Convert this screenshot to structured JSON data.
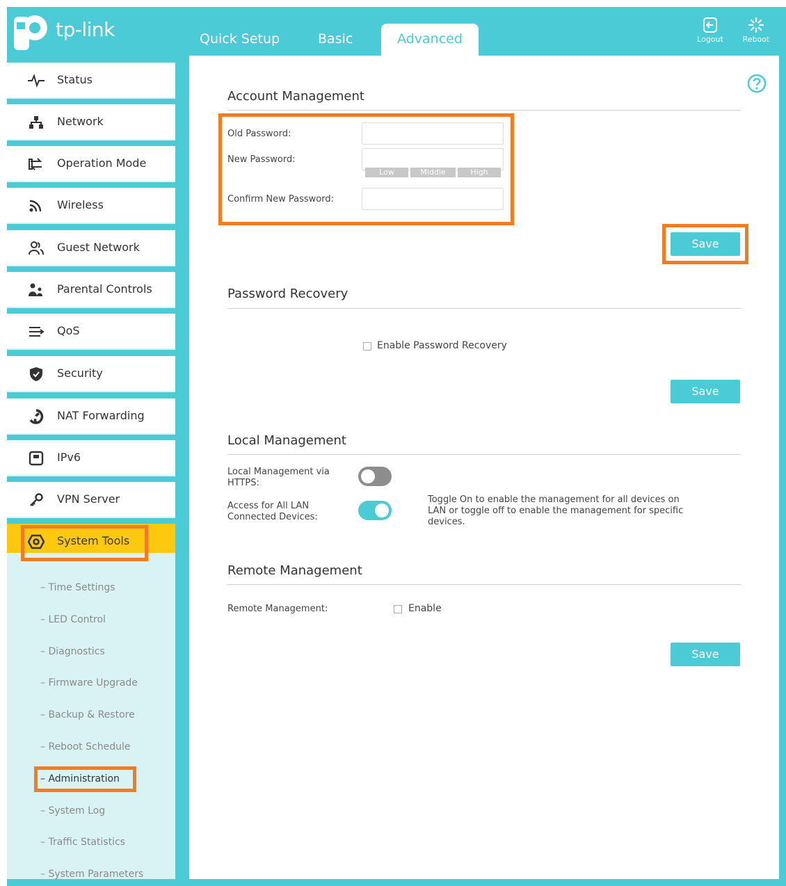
{
  "brand": {
    "name": "tp-link",
    "accent": "#4acbd6",
    "highlight": "#f47c20",
    "active_item": "#fdc90f"
  },
  "tabs": [
    {
      "label": "Quick Setup"
    },
    {
      "label": "Basic"
    },
    {
      "label": "Advanced"
    }
  ],
  "header_buttons": {
    "logout": "Logout",
    "reboot": "Reboot"
  },
  "sidebar": {
    "items": [
      {
        "label": "Status",
        "icon": "pulse-icon"
      },
      {
        "label": "Network",
        "icon": "network-icon"
      },
      {
        "label": "Operation Mode",
        "icon": "swap-icon"
      },
      {
        "label": "Wireless",
        "icon": "wireless-icon"
      },
      {
        "label": "Guest Network",
        "icon": "users-icon"
      },
      {
        "label": "Parental Controls",
        "icon": "family-icon"
      },
      {
        "label": "QoS",
        "icon": "qos-icon"
      },
      {
        "label": "Security",
        "icon": "shield-icon"
      },
      {
        "label": "NAT Forwarding",
        "icon": "nat-icon"
      },
      {
        "label": "IPv6",
        "icon": "ipv6-icon"
      },
      {
        "label": "VPN Server",
        "icon": "key-icon"
      },
      {
        "label": "System Tools",
        "icon": "gear-icon"
      }
    ],
    "sub_items": [
      "Time Settings",
      "LED Control",
      "Diagnostics",
      "Firmware Upgrade",
      "Backup & Restore",
      "Reboot Schedule",
      "Administration",
      "System Log",
      "Traffic Statistics",
      "System Parameters"
    ]
  },
  "account": {
    "title": "Account Management",
    "old_password_label": "Old Password:",
    "new_password_label": "New Password:",
    "confirm_label": "Confirm New Password:",
    "strength": {
      "low": "Low",
      "middle": "Middle",
      "high": "High"
    },
    "save": "Save"
  },
  "recovery": {
    "title": "Password Recovery",
    "enable_label": "Enable Password Recovery",
    "enabled": false,
    "save": "Save"
  },
  "local": {
    "title": "Local Management",
    "https_label": "Local Management via HTTPS:",
    "https_on": false,
    "lan_label": "Access for All LAN Connected Devices:",
    "lan_on": true,
    "note": "Toggle On to enable the management for all devices on LAN or toggle off to enable the management for specific devices."
  },
  "remote": {
    "title": "Remote Management",
    "label": "Remote Management:",
    "enable_label": "Enable",
    "enabled": false,
    "save": "Save"
  }
}
